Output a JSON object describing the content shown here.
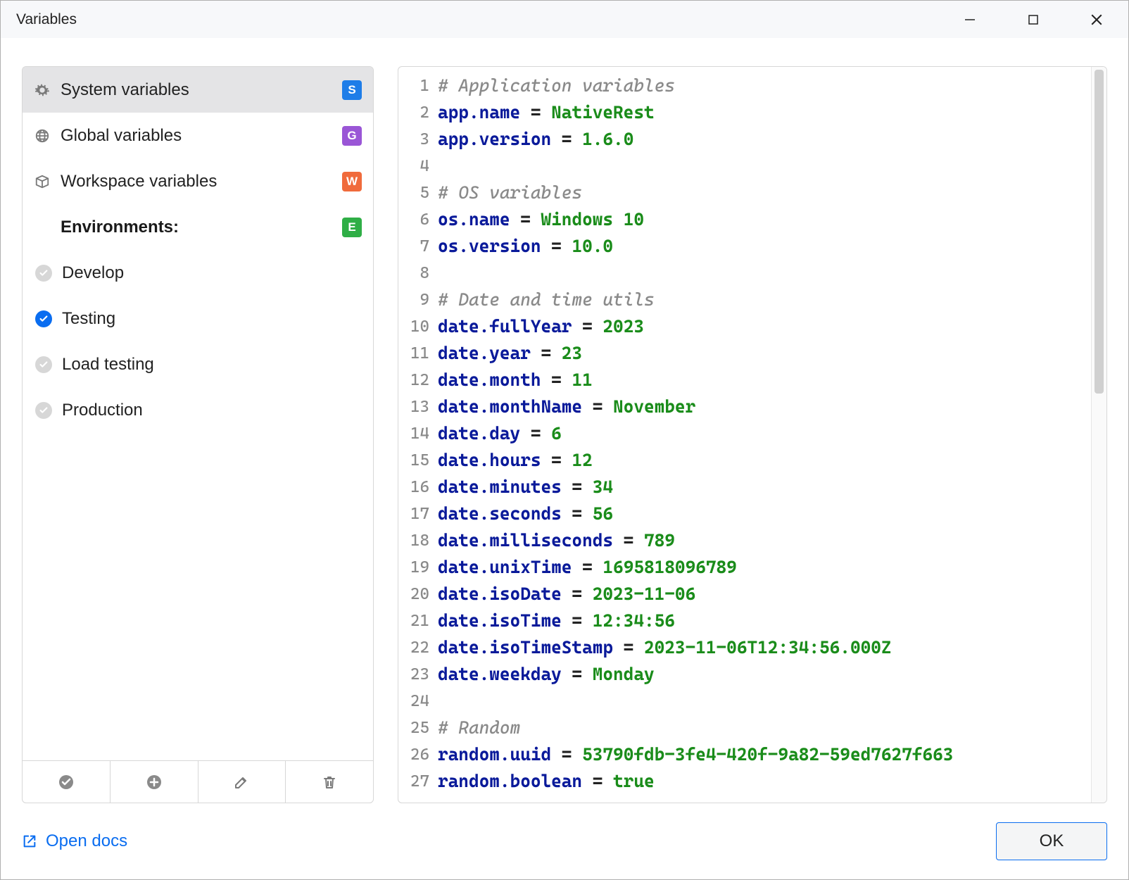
{
  "window": {
    "title": "Variables"
  },
  "sidebar": {
    "scopes": [
      {
        "id": "system",
        "label": "System variables",
        "badge": "S",
        "badge_color": "#1e7de8",
        "icon": "gear",
        "selected": true
      },
      {
        "id": "global",
        "label": "Global variables",
        "badge": "G",
        "badge_color": "#9a56d6",
        "icon": "globe",
        "selected": false
      },
      {
        "id": "workspace",
        "label": "Workspace variables",
        "badge": "W",
        "badge_color": "#f06b3c",
        "icon": "box",
        "selected": false
      }
    ],
    "environments_header": "Environments:",
    "environments_badge": {
      "text": "E",
      "color": "#2fae46"
    },
    "environments": [
      {
        "label": "Develop",
        "active": false
      },
      {
        "label": "Testing",
        "active": true
      },
      {
        "label": "Load testing",
        "active": false
      },
      {
        "label": "Production",
        "active": false
      }
    ],
    "toolbar": {
      "set_active": "Set active",
      "add": "Add environment",
      "edit": "Edit environment",
      "delete": "Delete environment"
    }
  },
  "editor": {
    "lines": [
      {
        "type": "comment",
        "text": "# Application variables"
      },
      {
        "type": "kv",
        "key": "app.name",
        "value": "NativeRest"
      },
      {
        "type": "kv",
        "key": "app.version",
        "value": "1.6.0"
      },
      {
        "type": "blank"
      },
      {
        "type": "comment",
        "text": "# OS variables"
      },
      {
        "type": "kv",
        "key": "os.name",
        "value": "Windows 10"
      },
      {
        "type": "kv",
        "key": "os.version",
        "value": "10.0"
      },
      {
        "type": "blank"
      },
      {
        "type": "comment",
        "text": "# Date and time utils"
      },
      {
        "type": "kv",
        "key": "date.fullYear",
        "value": "2023"
      },
      {
        "type": "kv",
        "key": "date.year",
        "value": "23"
      },
      {
        "type": "kv",
        "key": "date.month",
        "value": "11"
      },
      {
        "type": "kv",
        "key": "date.monthName",
        "value": "November"
      },
      {
        "type": "kv",
        "key": "date.day",
        "value": "6"
      },
      {
        "type": "kv",
        "key": "date.hours",
        "value": "12"
      },
      {
        "type": "kv",
        "key": "date.minutes",
        "value": "34"
      },
      {
        "type": "kv",
        "key": "date.seconds",
        "value": "56"
      },
      {
        "type": "kv",
        "key": "date.milliseconds",
        "value": "789"
      },
      {
        "type": "kv",
        "key": "date.unixTime",
        "value": "1695818096789"
      },
      {
        "type": "kv",
        "key": "date.isoDate",
        "value": "2023-11-06"
      },
      {
        "type": "kv",
        "key": "date.isoTime",
        "value": "12:34:56"
      },
      {
        "type": "kv",
        "key": "date.isoTimeStamp",
        "value": "2023-11-06T12:34:56.000Z"
      },
      {
        "type": "kv",
        "key": "date.weekday",
        "value": "Monday"
      },
      {
        "type": "blank"
      },
      {
        "type": "comment",
        "text": "# Random"
      },
      {
        "type": "kv",
        "key": "random.uuid",
        "value": "53790fdb-3fe4-420f-9a82-59ed7627f663"
      },
      {
        "type": "kv",
        "key": "random.boolean",
        "value": "true"
      }
    ]
  },
  "footer": {
    "open_docs": "Open docs",
    "ok": "OK"
  }
}
